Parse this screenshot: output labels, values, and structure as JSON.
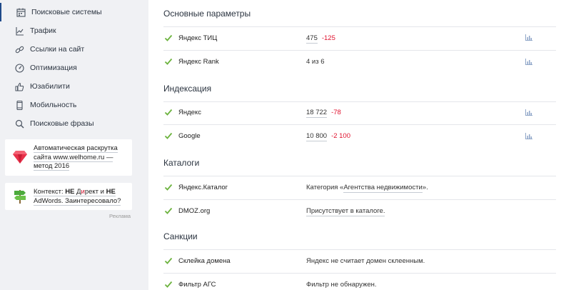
{
  "sidebar": {
    "items": [
      {
        "label": "Поисковые системы",
        "icon": "calendar-icon",
        "active": true
      },
      {
        "label": "Трафик",
        "icon": "traffic-icon"
      },
      {
        "label": "Ссылки на сайт",
        "icon": "link-icon"
      },
      {
        "label": "Оптимизация",
        "icon": "gauge-icon"
      },
      {
        "label": "Юзабилити",
        "icon": "thumbs-up-icon"
      },
      {
        "label": "Мобильность",
        "icon": "mobile-icon"
      },
      {
        "label": "Поисковые фразы",
        "icon": "search-icon"
      }
    ]
  },
  "ads": {
    "ad1": {
      "line1": "Автоматическая раскрутка",
      "line2": "сайта www.welhome.ru —",
      "line3": "метод 2016",
      "icon": "ruby-icon"
    },
    "ad2": {
      "l1_a": "Контекст: ",
      "l1_b": "НЕ",
      "l1_c": " Д",
      "l1_d": "и",
      "l1_e": "рект и ",
      "l1_f": "НЕ",
      "line2": "AdWords. Заинтересовало?",
      "icon": "signpost-icon"
    },
    "label": "Реклама"
  },
  "sections": {
    "main_params": {
      "title": "Основные параметры",
      "rows": [
        {
          "label": "Яндекс ТИЦ",
          "value": "475",
          "delta": "-125"
        },
        {
          "label": "Яндекс Rank",
          "value": "4 из 6"
        }
      ]
    },
    "indexing": {
      "title": "Индексация",
      "rows": [
        {
          "label": "Яндекс",
          "value": "18 722",
          "delta": "-78"
        },
        {
          "label": "Google",
          "value": "10 800",
          "delta": "-2 100"
        }
      ]
    },
    "catalogs": {
      "title": "Каталоги",
      "rows": [
        {
          "label": "Яндекс.Каталог",
          "value_pre": "Категория «",
          "value_link": "Агентства недвижимости",
          "value_post": "»."
        },
        {
          "label": "DMOZ.org",
          "value": "Присутствует в каталоге."
        }
      ]
    },
    "sanctions": {
      "title": "Санкции",
      "rows": [
        {
          "label": "Склейка домена",
          "value": "Яндекс не считает домен склеенным."
        },
        {
          "label": "Фильтр АГС",
          "value": "Фильтр не обнаружен."
        }
      ]
    }
  },
  "colors": {
    "accent": "#1f4a8a",
    "check": "#6db33f",
    "negative": "#e0122e",
    "chart_icon": "#8fa6c8"
  }
}
